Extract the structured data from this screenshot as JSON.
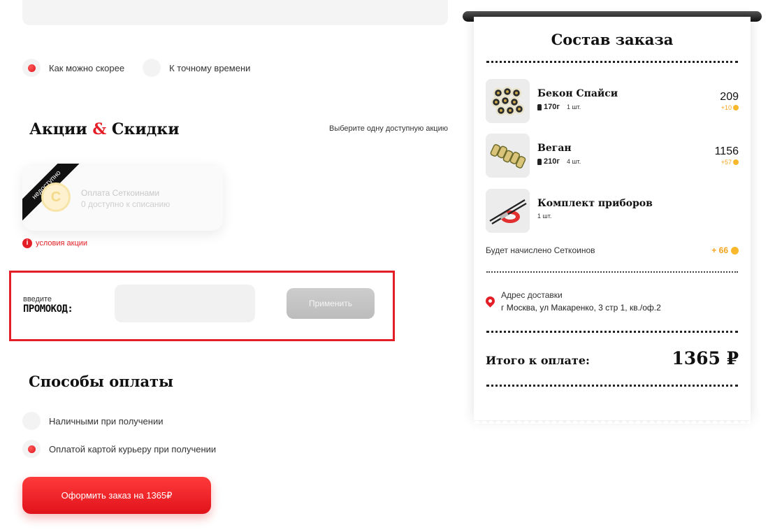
{
  "delivery_time": {
    "options": [
      {
        "label": "Как можно скорее",
        "selected": true
      },
      {
        "label": "К точному времени",
        "selected": false
      }
    ]
  },
  "promotions": {
    "title_part1": "Акции",
    "title_amp": "&",
    "title_part2": "Скидки",
    "hint": "Выберите одну доступную акцию",
    "card": {
      "ribbon": "недоступно",
      "coin_symbol": "С",
      "name": "Оплата Сеткоинами",
      "subtitle": "0 доступно к списанию"
    },
    "conditions_label": "условия акции"
  },
  "promocode": {
    "small_label": "введите",
    "big_label": "ПРОМОКОД:",
    "input_value": "",
    "apply_label": "Применить"
  },
  "payment": {
    "title": "Способы оплаты",
    "options": [
      {
        "label": "Наличными при получении",
        "selected": false
      },
      {
        "label": "Оплатой картой курьеру при получении",
        "selected": true
      }
    ]
  },
  "order_button": "Оформить заказ на 1365₽",
  "receipt": {
    "title": "Состав заказа",
    "items": [
      {
        "name": "Бекон Спайси",
        "weight": "170г",
        "qty": "1 шт.",
        "price": "209",
        "bonus": "+10"
      },
      {
        "name": "Веган",
        "weight": "210г",
        "qty": "4 шт.",
        "price": "1156",
        "bonus": "+57"
      },
      {
        "name": "Комплект приборов",
        "weight": "",
        "qty": "1 шт.",
        "price": "",
        "bonus": ""
      }
    ],
    "accrue_label": "Будет начислено Сеткоинов",
    "accrue_value": "+ 66",
    "address_label": "Адрес доставки",
    "address_value": "г Москва, ул Макаренко, 3 стр 1, кв./оф.2",
    "total_label": "Итого к оплате:",
    "total_value": "1365 ₽"
  },
  "colors": {
    "accent": "#e41e26",
    "coin": "#f3a31c"
  }
}
